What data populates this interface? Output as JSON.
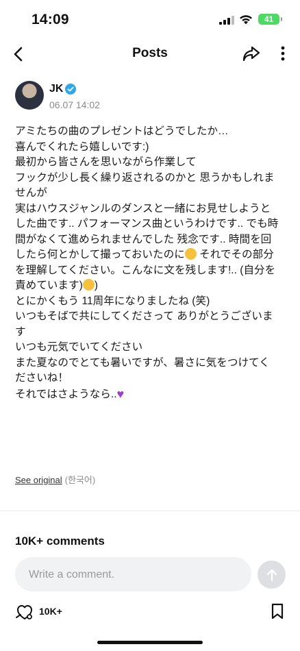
{
  "status_bar": {
    "time": "14:09",
    "battery": "41"
  },
  "nav": {
    "title": "Posts"
  },
  "author": {
    "name": "JK",
    "date": "06.07 14:02"
  },
  "post": {
    "lines": [
      "アミたちの曲のプレゼントはどうでしたか…",
      "喜んでくれたら嬉しいです:)",
      "最初から皆さんを思いながら作業して",
      "フックが少し長く繰り返されるのかと 思うかもしれま",
      "せんが",
      "実はハウスジャンルのダンスと一緒にお見せしようと",
      "した曲です.. パフォーマンス曲というわけです.. でも時",
      "間がなくて進められませんでした 残念です.. 時間を回",
      "したら何とかして撮っておいたのに",
      " それでその部分",
      "を理解してください。こんなに文を残します!.. (自分を",
      "責めています)",
      ")",
      "とにかくもう 11周年になりましたね (笑)",
      "いつもそばで共にしてくださって ありがとうございま",
      "す",
      "いつも元気でいてください",
      "また夏なのでとても暑いですが、暑さに気をつけてく",
      "ださいね！",
      "それではさようなら.."
    ]
  },
  "see_original": {
    "link": "See original",
    "lang": "(한국어)"
  },
  "comments": {
    "title": "10K+ comments",
    "placeholder": "Write a comment."
  },
  "footer": {
    "reactions": "10K+"
  },
  "icons": {
    "back": "chevron-left-icon",
    "share": "share-icon",
    "more": "more-vertical-icon",
    "verified": "verified-badge-icon",
    "send": "send-arrow-icon",
    "react": "react-icon",
    "bookmark": "bookmark-icon"
  },
  "colors": {
    "verified": "#2fa7e8",
    "battery": "#4cd964",
    "heart": "#9b3fd1"
  }
}
